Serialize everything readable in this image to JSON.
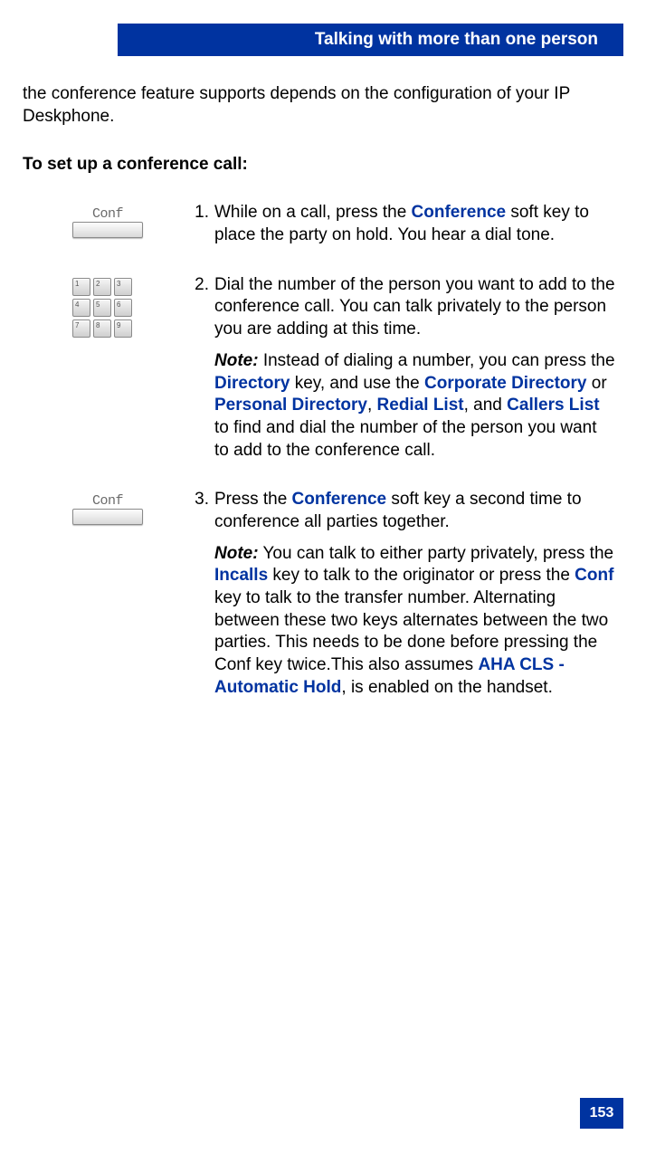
{
  "header": {
    "title": "Talking with more than one person"
  },
  "intro": "the conference feature supports depends on the configuration of your IP Deskphone.",
  "sectionHeading": "To set up a conference call:",
  "steps": {
    "s1": {
      "num": "1.",
      "softkey": "Conf",
      "pre": "While on a call, press the ",
      "key1": "Conference",
      "post": " soft key to place the party on hold. You hear a dial tone."
    },
    "s2": {
      "num": "2.",
      "main": "Dial the number of the person you want to add to the conference call. You can talk privately to the person you are adding at this time.",
      "noteLabel": "Note:",
      "n_pre": " Instead of dialing a number, you can press the ",
      "n_key1": "Directory",
      "n_mid1": " key, and use the ",
      "n_key2": "Corporate Directory",
      "n_mid2": " or ",
      "n_key3": "Personal Directory",
      "n_mid3": ", ",
      "n_key4": "Redial List",
      "n_mid4": ", and ",
      "n_key5": "Callers List",
      "n_post": " to find and dial the number of the person you want to add to the conference call."
    },
    "s3": {
      "num": "3.",
      "softkey": "Conf",
      "m_pre": "Press the ",
      "m_key1": "Conference",
      "m_post": " soft key a second time to conference all parties together.",
      "noteLabel": "Note:",
      "n_pre": " You can talk to either party privately, press the ",
      "n_key1": "Incalls",
      "n_mid1": " key to talk to the originator or press the ",
      "n_key2": "Conf",
      "n_mid2": " key to talk to the transfer number. Alternating between these two keys alternates between the two parties. This needs to be done before pressing the Conf key twice.This also assumes ",
      "n_key3": "AHA CLS - Automatic Hold",
      "n_post": ", is enabled on the handset."
    }
  },
  "pageNumber": "153"
}
